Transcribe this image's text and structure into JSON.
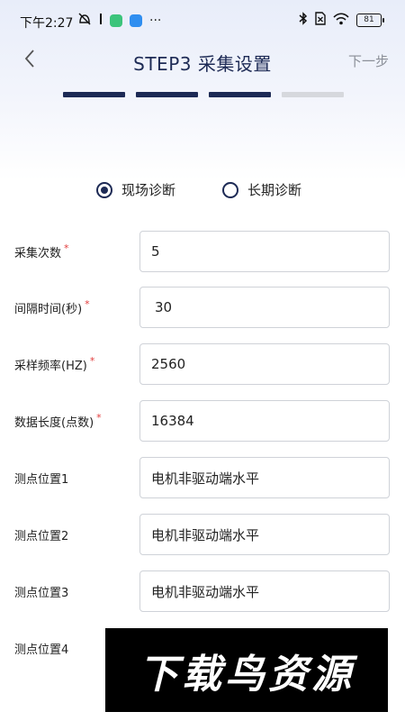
{
  "status_bar": {
    "time": "下午2:27",
    "more": "···",
    "battery": "81"
  },
  "header": {
    "title": "STEP3 采集设置",
    "next_label": "下一步"
  },
  "progress": {
    "total_steps": 4,
    "completed_steps": 3,
    "active_color": "#1d2a55",
    "inactive_color": "#d6d8dd"
  },
  "mode": {
    "options": [
      "现场诊断",
      "长期诊断"
    ],
    "selected": "现场诊断"
  },
  "form": {
    "required_mark": "*",
    "fields": [
      {
        "label": "采集次数",
        "required": true,
        "value": "5"
      },
      {
        "label": "间隔时间(秒)",
        "required": true,
        "value": "30"
      },
      {
        "label": "采样频率(HZ)",
        "required": true,
        "value": "2560"
      },
      {
        "label": "数据长度(点数)",
        "required": true,
        "value": "16384"
      },
      {
        "label": "测点位置1",
        "required": false,
        "value": "电机非驱动端水平"
      },
      {
        "label": "测点位置2",
        "required": false,
        "value": "电机非驱动端水平"
      },
      {
        "label": "测点位置3",
        "required": false,
        "value": "电机非驱动端水平"
      },
      {
        "label": "测点位置4",
        "required": false,
        "value": ""
      }
    ]
  },
  "watermark": {
    "text": "下载鸟资源"
  }
}
